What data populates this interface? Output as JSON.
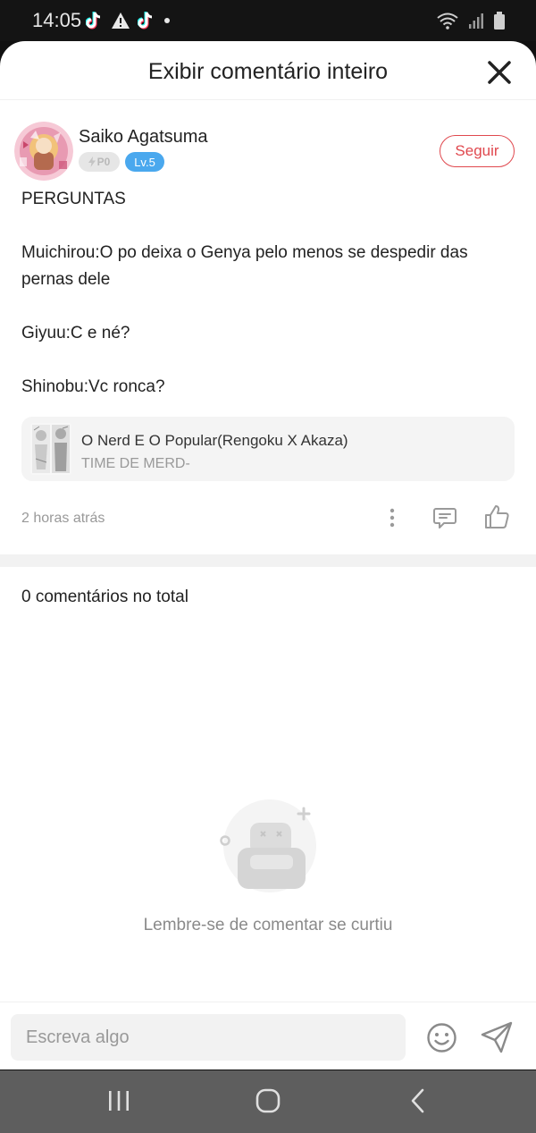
{
  "status_bar": {
    "time": "14:05"
  },
  "header": {
    "title": "Exibir comentário inteiro"
  },
  "author": {
    "name": "Saiko Agatsuma",
    "points_badge": "P0",
    "level_badge": "Lv.5",
    "follow_label": "Seguir"
  },
  "comment": {
    "heading": "PERGUNTAS",
    "line_1a": "Muichirou:O po deixa o Genya pelo menos se despedir das",
    "line_1b": "pernas dele",
    "line_2": "Giyuu:C e né?",
    "line_3": "Shinobu:Vc ronca?"
  },
  "book": {
    "title": "O Nerd E O Popular(Rengoku X Akaza)",
    "subtitle": "TIME DE MERD-"
  },
  "meta": {
    "timestamp": "2 horas atrás"
  },
  "comments_section": {
    "total_label": "0 comentários no total",
    "empty_message": "Lembre-se de comentar se curtiu"
  },
  "composer": {
    "placeholder": "Escreva algo"
  },
  "colors": {
    "accent_red": "#e0484e",
    "level_blue": "#4aa8ee",
    "nav_gray": "#5e5e5e"
  },
  "icons": {
    "close": "close-icon",
    "more": "more-vertical-icon",
    "reply": "comment-icon",
    "like": "thumbs-up-icon",
    "emoji": "smiley-icon",
    "send": "send-icon"
  }
}
